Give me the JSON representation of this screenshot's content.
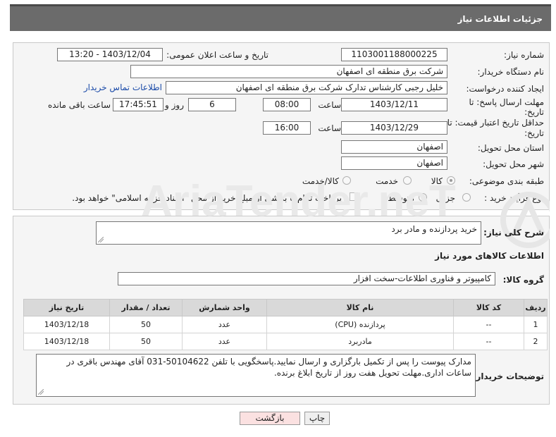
{
  "header": {
    "title": "جزئیات اطلاعات نیاز"
  },
  "form": {
    "need_number_label": "شماره نیاز:",
    "need_number": "1103001188000225",
    "announce_label": "تاریخ و ساعت اعلان عمومی:",
    "announce_value": "1403/12/04 - 13:20",
    "buyer_org_label": "نام دستگاه خریدار:",
    "buyer_org": "شرکت برق منطقه ای اصفهان",
    "requester_label": "ایجاد کننده درخواست:",
    "requester": "خلیل رجبی کارشناس تدارک شرکت برق منطقه ای اصفهان",
    "contact_link": "اطلاعات تماس خریدار",
    "deadline_label_1": "مهلت ارسال پاسخ: تا",
    "deadline_label_2": "تاریخ:",
    "deadline_date": "1403/12/11",
    "time_label": "ساعت",
    "deadline_time": "08:00",
    "days_value": "6",
    "days_label": "روز و",
    "remaining_time": "17:45:51",
    "remaining_label": "ساعت باقی مانده",
    "validity_label_1": "حداقل تاریخ اعتبار قیمت: تا",
    "validity_label_2": "تاریخ:",
    "validity_date": "1403/12/29",
    "validity_time": "16:00",
    "province_label": "استان محل تحویل:",
    "province": "اصفهان",
    "city_label": "شهر محل تحویل:",
    "city": "اصفهان",
    "category_label": "طبقه بندی موضوعی:",
    "category_options": [
      "کالا",
      "خدمت",
      "کالا/خدمت"
    ],
    "category_selected": "کالا",
    "process_label": "نوع فرآیند خرید :",
    "process_options": [
      "جزیی",
      "متوسط"
    ],
    "process_selected": "متوسط",
    "payment_note": "پرداخت تمام یا بخشی از مبلغ خرید،از محل \"اسناد خزانه اسلامی\" خواهد بود."
  },
  "details": {
    "summary_label": "شرح کلی نیاز:",
    "summary_value": "خرید پردازنده و مادر برد",
    "goods_info_title": "اطلاعات کالاهای مورد نیاز",
    "goods_group_label": "گروه کالا:",
    "goods_group_value": "کامپیوتر و فناوری اطلاعات-سخت افزار",
    "table": {
      "headers": [
        "ردیف",
        "کد کالا",
        "نام کالا",
        "واحد شمارش",
        "تعداد / مقدار",
        "تاریخ نیاز"
      ],
      "rows": [
        [
          "1",
          "--",
          "پردازنده (CPU)",
          "عدد",
          "50",
          "1403/12/18"
        ],
        [
          "2",
          "--",
          "مادربرد",
          "عدد",
          "50",
          "1403/12/18"
        ]
      ]
    },
    "buyer_notes_label": "توضیحات خریدار:",
    "buyer_notes": "مدارک پیوست را پس از تکمیل بارگزاری و ارسال نمایید.پاسخگویی با تلفن 50104622-031 آقای مهندس باقری در ساعات اداری.مهلت تحویل هفت روز از تاریخ ابلاغ برنده."
  },
  "buttons": {
    "print": "چاپ",
    "back": "بازگشت"
  },
  "watermark": {
    "text": "AriaTender.neT"
  },
  "colors": {
    "header_bg": "#6b6b6b",
    "panel_bg": "#f5f5f5",
    "link": "#1a4aa8",
    "back_button": "#fbe1e1"
  }
}
